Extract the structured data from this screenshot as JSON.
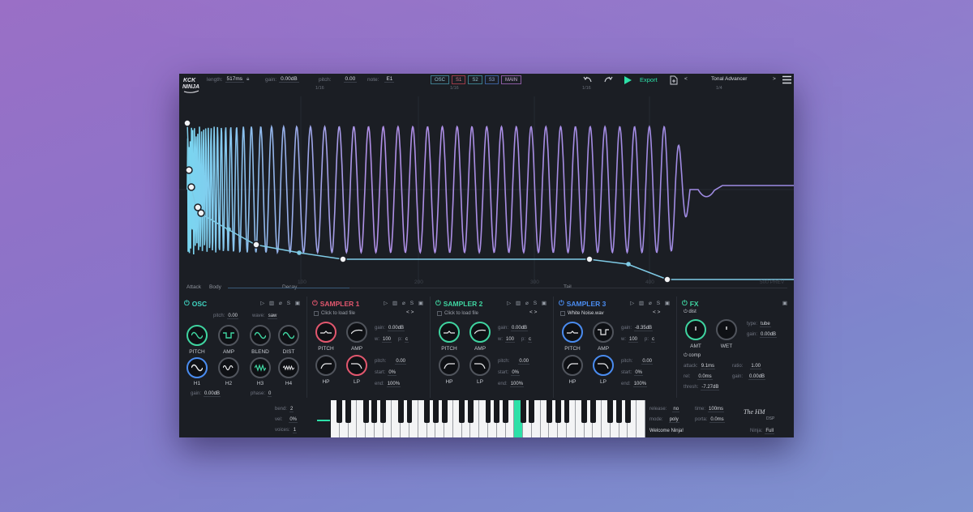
{
  "topbar": {
    "length_label": "length:",
    "length_value": "517ms",
    "gain_label": "gain:",
    "gain_value": "0.00dB",
    "pitch_label": "pitch:",
    "pitch_value": "0.00",
    "note_label": "note:",
    "note_value": "E1",
    "tabs": [
      "OSC",
      "S1",
      "S2",
      "S3",
      "MAIN"
    ],
    "export_label": "Export",
    "preset_prev": "<",
    "preset_name": "Tonal Advancer",
    "preset_next": ">",
    "grid_values": [
      "1/16",
      "1/16",
      "1/16",
      "1/4"
    ]
  },
  "graph": {
    "axis_labels": [
      "100",
      "200",
      "300",
      "400",
      "500 PREV"
    ]
  },
  "envelope": {
    "stages": [
      "Attack",
      "Body",
      "Decay",
      "Tail"
    ]
  },
  "osc": {
    "title": "OSC",
    "icons": "▷ ▥ ⌀ S ▣",
    "pitch_label": "pitch:",
    "pitch_value": "0.00",
    "wave_label": "wave:",
    "wave_value": "saw",
    "knobs_row1": [
      "PITCH",
      "AMP",
      "BLEND",
      "DIST"
    ],
    "knobs_row2": [
      "H1",
      "H2",
      "H3",
      "H4"
    ],
    "gain_label": "gain:",
    "gain_value": "0.00dB",
    "phase_label": "phase:",
    "phase_value": "0"
  },
  "sampler1": {
    "title": "SAMPLER 1",
    "icons": "▷ ▥ ⌀ S ▣",
    "file": "Click to load file",
    "nav": "<  >",
    "gain_label": "gain:",
    "gain_value": "0.00dB",
    "w_label": "w:",
    "w_value": "100",
    "p_label": "p:",
    "p_value": "c",
    "pitch_label": "pitch:",
    "pitch_value": "0.00",
    "start_label": "start:",
    "start_value": "0%",
    "end_label": "end:",
    "end_value": "100%",
    "knobs": [
      "PITCH",
      "AMP",
      "HP",
      "LP"
    ]
  },
  "sampler2": {
    "title": "SAMPLER 2",
    "icons": "▷ ▥ ⌀ S ▣",
    "file": "Click to load file",
    "nav": "<  >",
    "gain_label": "gain:",
    "gain_value": "0.00dB",
    "w_label": "w:",
    "w_value": "100",
    "p_label": "p:",
    "p_value": "c",
    "pitch_label": "pitch:",
    "pitch_value": "0.00",
    "start_label": "start:",
    "start_value": "0%",
    "end_label": "end:",
    "end_value": "100%",
    "knobs": [
      "PITCH",
      "AMP",
      "HP",
      "LP"
    ]
  },
  "sampler3": {
    "title": "SAMPLER 3",
    "icons": "▷ ▥ ⌀ S ▣",
    "file": "White Noise.wav",
    "nav": "<  >",
    "gain_label": "gain:",
    "gain_value": "-8.35dB",
    "w_label": "w:",
    "w_value": "100",
    "p_label": "p:",
    "p_value": "c",
    "pitch_label": "pitch:",
    "pitch_value": "0.00",
    "start_label": "start:",
    "start_value": "0%",
    "end_label": "end:",
    "end_value": "100%",
    "knobs": [
      "PITCH",
      "AMP",
      "HP",
      "LP"
    ]
  },
  "fx": {
    "title": "FX",
    "icons": "▣",
    "dist_label": "dist",
    "amt_label": "AMT",
    "wet_label": "WET",
    "type_label": "type:",
    "type_value": "tube",
    "gain_label": "gain:",
    "gain_value": "0.00dB",
    "comp_label": "comp",
    "attack_label": "attack:",
    "attack_value": "9.1ms",
    "ratio_label": "ratio:",
    "ratio_value": "1.00",
    "rel_label": "rel:",
    "rel_value": "0.0ms",
    "cgain_label": "gain:",
    "cgain_value": "0.00dB",
    "thresh_label": "thresh:",
    "thresh_value": "-7.27dB"
  },
  "bottom": {
    "bend_label": "bend:",
    "bend_value": "2",
    "vel_label": "vel:",
    "vel_value": "0%",
    "voices_label": "voices:",
    "voices_value": "1",
    "release_label": "release:",
    "release_value": "no",
    "time_label": "time:",
    "time_value": "100ms",
    "mode_label": "mode:",
    "mode_value": "poly",
    "porta_label": "porta:",
    "porta_value": "0.0ms",
    "status": "Welcome Ninja!",
    "ninja_label": "Ninja:",
    "ninja_value": "Full"
  },
  "colors": {
    "accent_green": "#2de0a8",
    "osc": "#3fd4c0",
    "sampler1": "#e2576e",
    "sampler2": "#3fd4a0",
    "sampler3": "#4a8cf0",
    "fx": "#3fd4a0"
  }
}
